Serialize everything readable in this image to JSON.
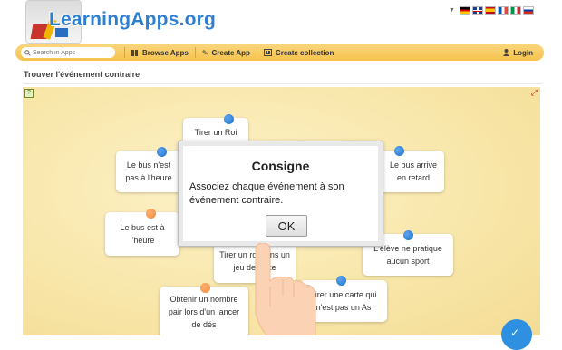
{
  "header": {
    "logo_text": "LearningApps.org",
    "languages": [
      "de",
      "en",
      "es",
      "fr",
      "it",
      "ru"
    ]
  },
  "nav": {
    "search_placeholder": "Search in Apps",
    "browse_label": "Browse Apps",
    "create_label": "Create App",
    "collection_label": "Create collection",
    "login_label": "Login"
  },
  "page": {
    "title": "Trouver l'événement contraire"
  },
  "cards": [
    {
      "text": "Tirer un Roi",
      "pin": "blue"
    },
    {
      "text": "Le bus n'est pas à l'heure",
      "pin": "blue"
    },
    {
      "text": "Le bus arrive en retard",
      "pin": "blue"
    },
    {
      "text": "Le bus est à l'heure",
      "pin": "orange"
    },
    {
      "text": "L'élève ne pratique aucun sport",
      "pin": "blue"
    },
    {
      "text": "Tirer un roi dans un jeu de carte",
      "pin": "none"
    },
    {
      "text": "Tirer une carte qui n'est pas un As",
      "pin": "blue"
    },
    {
      "text": "Obtenir un nombre pair lors d'un lancer de dés",
      "pin": "orange"
    }
  ],
  "dialog": {
    "title": "Consigne",
    "body": "Associez chaque événement à son événement contraire.",
    "ok_label": "OK"
  },
  "colors": {
    "accent": "#f5c24c",
    "logo": "#2f7fd1",
    "pin_blue": "#1f6fc4",
    "pin_orange": "#ee8a3a"
  }
}
